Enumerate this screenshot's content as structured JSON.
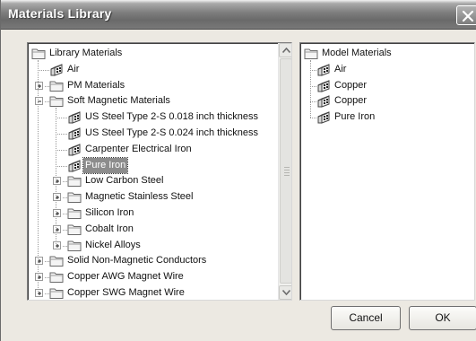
{
  "window": {
    "title": "Materials Library"
  },
  "library_tree": {
    "root_label": "Library Materials",
    "items": [
      {
        "label": "Air",
        "kind": "material",
        "level": 1
      },
      {
        "label": "PM Materials",
        "kind": "folder",
        "level": 1,
        "expanded": false
      },
      {
        "label": "Soft Magnetic Materials",
        "kind": "folder",
        "level": 1,
        "expanded": true
      },
      {
        "label": "US Steel Type 2-S 0.018 inch thickness",
        "kind": "material",
        "level": 2
      },
      {
        "label": "US Steel Type 2-S 0.024 inch thickness",
        "kind": "material",
        "level": 2
      },
      {
        "label": "Carpenter Electrical Iron",
        "kind": "material",
        "level": 2
      },
      {
        "label": "Pure Iron",
        "kind": "material",
        "level": 2,
        "selected": true
      },
      {
        "label": "Low Carbon Steel",
        "kind": "folder",
        "level": 2,
        "expanded": false
      },
      {
        "label": "Magnetic Stainless Steel",
        "kind": "folder",
        "level": 2,
        "expanded": false
      },
      {
        "label": "Silicon Iron",
        "kind": "folder",
        "level": 2,
        "expanded": false
      },
      {
        "label": "Cobalt Iron",
        "kind": "folder",
        "level": 2,
        "expanded": false
      },
      {
        "label": "Nickel Alloys",
        "kind": "folder",
        "level": 2,
        "expanded": false
      },
      {
        "label": "Solid Non-Magnetic Conductors",
        "kind": "folder",
        "level": 1,
        "expanded": false
      },
      {
        "label": "Copper AWG Magnet Wire",
        "kind": "folder",
        "level": 1,
        "expanded": false
      },
      {
        "label": "Copper SWG Magnet Wire",
        "kind": "folder",
        "level": 1,
        "expanded": false
      }
    ]
  },
  "model_tree": {
    "root_label": "Model Materials",
    "items": [
      {
        "label": "Air",
        "kind": "material"
      },
      {
        "label": "Copper",
        "kind": "material"
      },
      {
        "label": "Copper",
        "kind": "material"
      },
      {
        "label": "Pure Iron",
        "kind": "material"
      }
    ]
  },
  "buttons": {
    "cancel_label": "Cancel",
    "ok_label": "OK"
  },
  "icons": {
    "folder": "folder-icon",
    "material": "material-icon",
    "close": "close-icon",
    "scroll_up": "scroll-up-arrow-icon",
    "scroll_down": "scroll-down-arrow-icon"
  },
  "colors": {
    "selection": "#8c8c8c",
    "titlebar": "#6e6e6e"
  }
}
